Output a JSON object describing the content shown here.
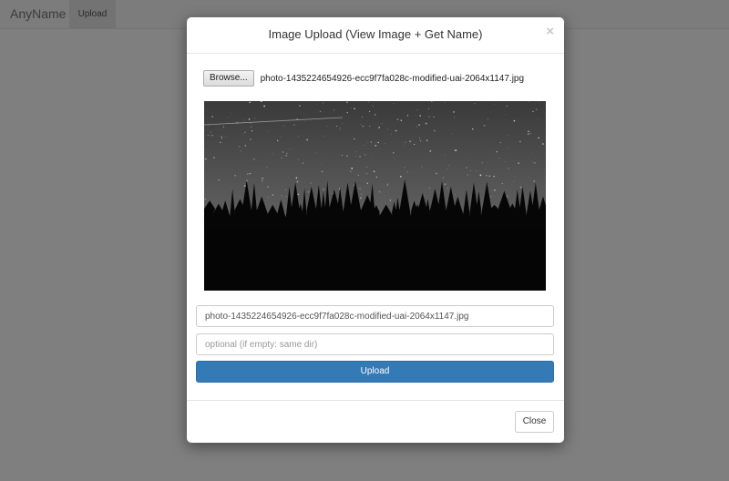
{
  "navbar": {
    "brand": "AnyName",
    "items": [
      {
        "label": "Upload"
      }
    ]
  },
  "modal": {
    "title": "Image Upload (View Image + Get Name)",
    "close_symbol": "×",
    "file_picker": {
      "button_label": "Browse...",
      "file_name": "photo-1435224654926-ecc9f7fa028c-modified-uai-2064x1147.jpg"
    },
    "preview": {
      "icon": "image-preview",
      "description_colors": {
        "sky": "#4a4a4a",
        "trees": "#060606"
      }
    },
    "name_input": {
      "value": "photo-1435224654926-ecc9f7fa028c-modified-uai-2064x1147.jpg",
      "placeholder": ""
    },
    "dir_input": {
      "value": "",
      "placeholder": "optional (if empty: same dir)"
    },
    "upload_label": "Upload",
    "close_label": "Close"
  },
  "colors": {
    "primary": "#337ab7",
    "backdrop": "rgba(0,0,0,0.5)"
  }
}
